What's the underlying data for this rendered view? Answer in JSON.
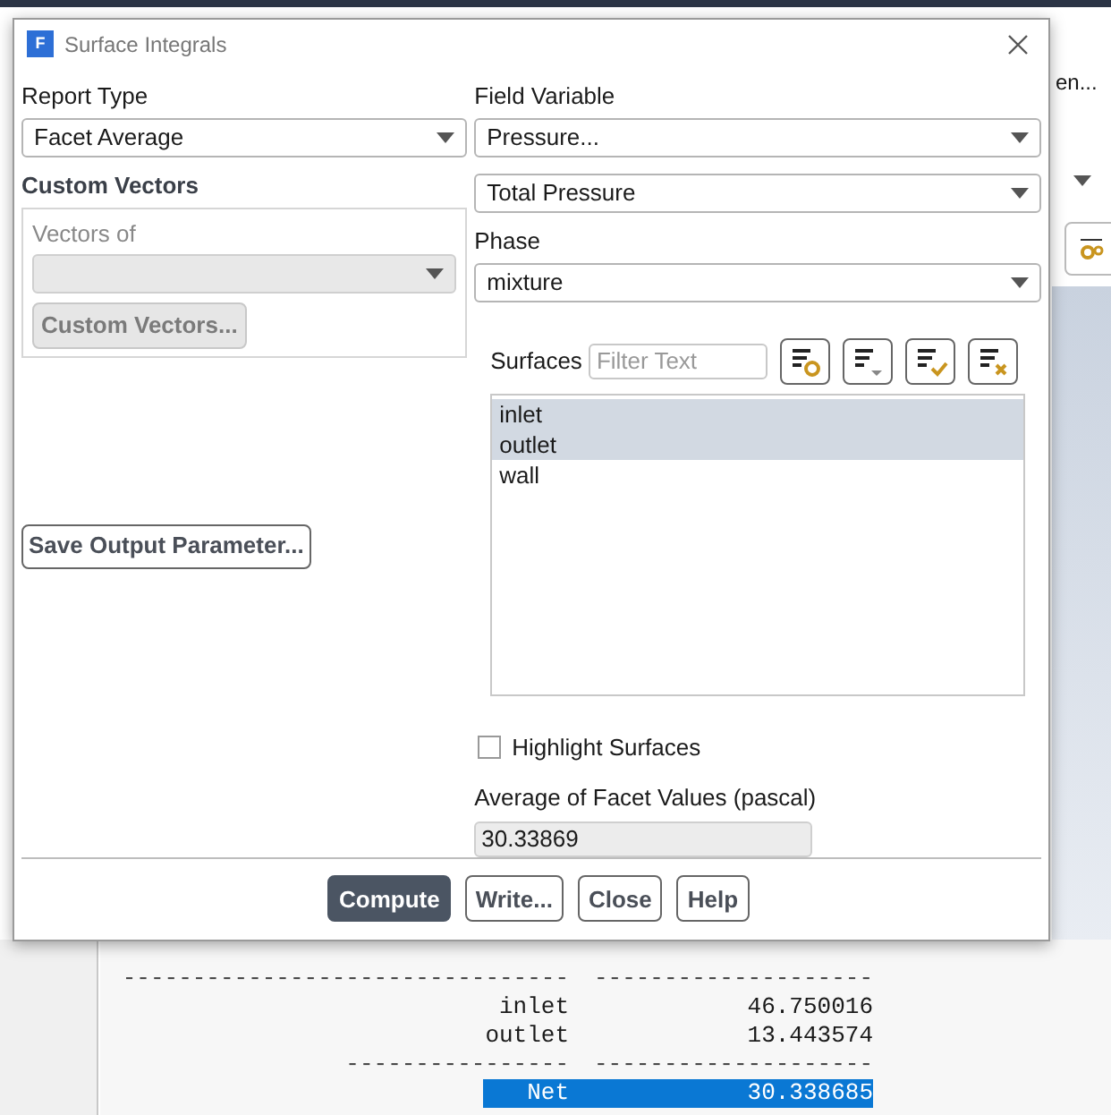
{
  "window": {
    "title": "Surface Integrals",
    "icon_letter": "F"
  },
  "report_type": {
    "label": "Report Type",
    "value": "Facet Average"
  },
  "custom_vectors": {
    "heading": "Custom Vectors",
    "vectors_of_label": "Vectors of",
    "button": "Custom Vectors...",
    "disabled": true
  },
  "save_button": "Save Output Parameter...",
  "field_variable": {
    "label": "Field Variable",
    "value": "Pressure...",
    "sub_value": "Total Pressure"
  },
  "phase": {
    "label": "Phase",
    "value": "mixture"
  },
  "surfaces": {
    "label": "Surfaces",
    "filter_placeholder": "Filter Text",
    "tools": [
      {
        "kind": "select"
      },
      {
        "kind": "menu"
      },
      {
        "kind": "check"
      },
      {
        "kind": "clear"
      }
    ],
    "items": [
      {
        "label": "inlet",
        "selected": true
      },
      {
        "label": "outlet",
        "selected": true
      },
      {
        "label": "wall",
        "selected": false
      }
    ]
  },
  "highlight": {
    "label": "Highlight Surfaces",
    "checked": false
  },
  "result": {
    "label": "Average of Facet Values (pascal)",
    "value": "30.33869"
  },
  "buttons": [
    {
      "label": "Compute",
      "primary": true
    },
    {
      "label": "Write...",
      "primary": false
    },
    {
      "label": "Close",
      "primary": false
    },
    {
      "label": "Help",
      "primary": false
    }
  ],
  "background": {
    "right_text": "en...",
    "console": [
      {
        "kind": "separator",
        "col1": "--------------------------------",
        "col2": "--------------------",
        "selected": false
      },
      {
        "kind": "row",
        "col1": "inlet",
        "col2": "46.750016",
        "selected": false
      },
      {
        "kind": "row",
        "col1": "outlet",
        "col2": "13.443574",
        "selected": false
      },
      {
        "kind": "separator",
        "col1": "----------------",
        "col2": "--------------------",
        "selected": false
      },
      {
        "kind": "row",
        "col1": "Net",
        "col2": "30.338685",
        "selected": true
      }
    ]
  }
}
